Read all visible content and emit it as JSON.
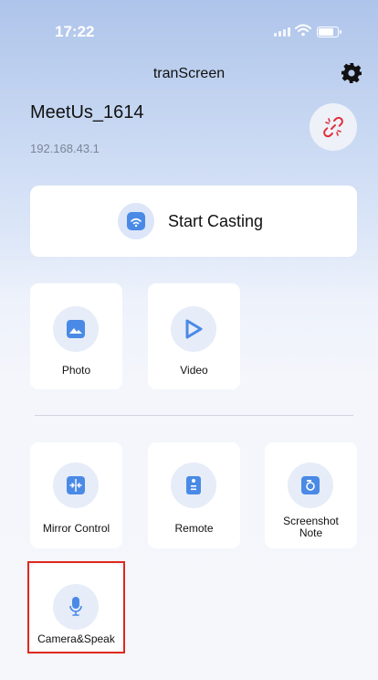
{
  "status": {
    "time": "17:22"
  },
  "header": {
    "title": "tranScreen"
  },
  "device": {
    "name": "MeetUs_1614",
    "ip": "192.168.43.1"
  },
  "cast": {
    "label": "Start Casting"
  },
  "media_tiles": [
    {
      "label": "Photo",
      "icon": "photo-icon"
    },
    {
      "label": "Video",
      "icon": "video-play-icon"
    }
  ],
  "tool_tiles": [
    {
      "label": "Mirror Control",
      "icon": "mirror-control-icon"
    },
    {
      "label": "Remote",
      "icon": "remote-icon"
    },
    {
      "label": "Screenshot Note",
      "icon": "camera-icon"
    },
    {
      "label": "Camera&Speak",
      "icon": "microphone-icon"
    }
  ],
  "colors": {
    "accent": "#4a8ae6",
    "highlight": "#e0281e",
    "disconnect": "#e0303a"
  }
}
